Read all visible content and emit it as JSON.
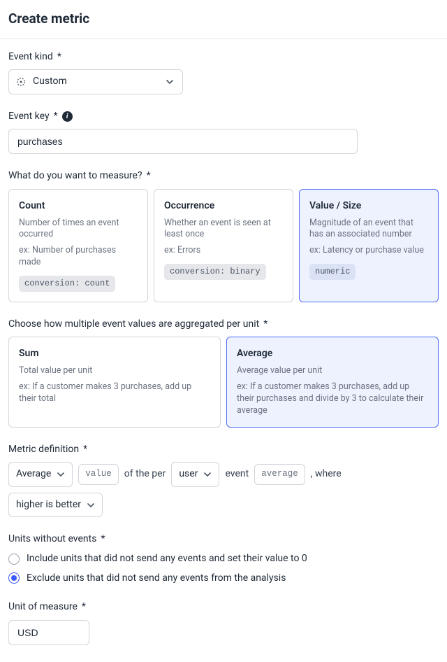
{
  "header": {
    "title": "Create metric"
  },
  "event_kind": {
    "label": "Event kind",
    "required": "*",
    "value": "Custom"
  },
  "event_key": {
    "label": "Event key",
    "required": "*",
    "value": "purchases"
  },
  "measure": {
    "label": "What do you want to measure?",
    "required": "*",
    "options": [
      {
        "title": "Count",
        "sub": "Number of times an event occurred",
        "ex": "ex: Number of purchases made",
        "chip": "conversion: count",
        "selected": false
      },
      {
        "title": "Occurrence",
        "sub": "Whether an event is seen at least once",
        "ex": "ex: Errors",
        "chip": "conversion: binary",
        "selected": false
      },
      {
        "title": "Value / Size",
        "sub": "Magnitude of an event that has an associated number",
        "ex": "ex: Latency or purchase value",
        "chip": "numeric",
        "selected": true
      }
    ]
  },
  "aggregate": {
    "label": "Choose how multiple event values are aggregated per unit",
    "required": "*",
    "options": [
      {
        "title": "Sum",
        "sub": "Total value per unit",
        "ex": "ex: If a customer makes 3 purchases, add up their total",
        "selected": false
      },
      {
        "title": "Average",
        "sub": "Average value per unit",
        "ex": "ex: If a customer makes 3 purchases, add up their purchases and divide by 3 to calculate their average",
        "selected": true
      }
    ]
  },
  "definition": {
    "label": "Metric definition",
    "required": "*",
    "agg": "Average",
    "value_chip": "value",
    "text1": "of the per",
    "unit": "user",
    "text2": "event",
    "avg_chip": "average",
    "text3": ", where",
    "direction": "higher is better"
  },
  "units_without": {
    "label": "Units without events",
    "required": "*",
    "options": [
      {
        "label": "Include units that did not send any events and set their value to 0",
        "selected": false
      },
      {
        "label": "Exclude units that did not send any events from the analysis",
        "selected": true
      }
    ]
  },
  "uom": {
    "label": "Unit of measure",
    "required": "*",
    "value": "USD"
  }
}
